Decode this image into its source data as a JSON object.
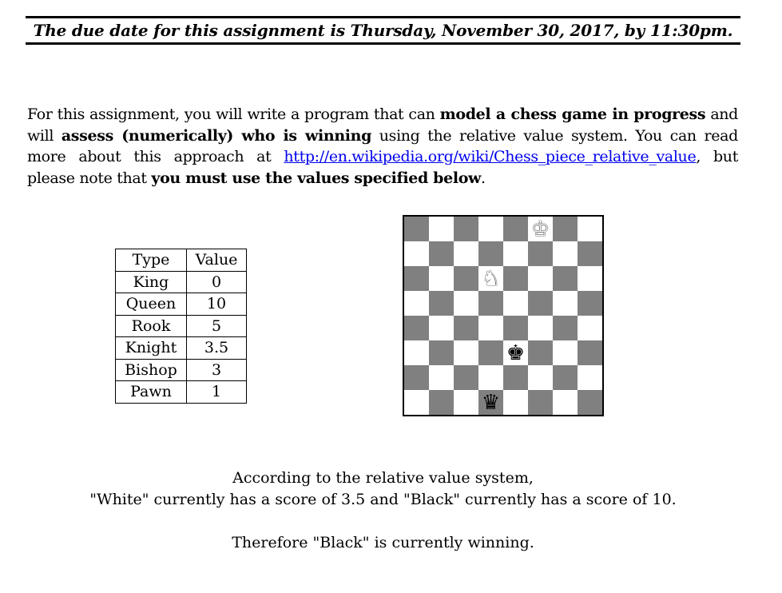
{
  "due_date": "The due date for this assignment is Thursday, November 30, 2017, by 11:30pm.",
  "intro": {
    "t1": "For this assignment, you will write a program that can ",
    "b1": "model a chess game in progress",
    "t2": " and will ",
    "b2": "assess (numerically) who is winning",
    "t3": " using the relative value system. You can read more about this approach at ",
    "link": "http://en.wikipedia.org/wiki/Chess_piece_relative_value",
    "t4": ", but please note that ",
    "b3": "you must use the values specified below",
    "t5": "."
  },
  "table": {
    "headers": [
      "Type",
      "Value"
    ],
    "rows": [
      [
        "King",
        "0"
      ],
      [
        "Queen",
        "10"
      ],
      [
        "Rook",
        "5"
      ],
      [
        "Knight",
        "3.5"
      ],
      [
        "Bishop",
        "3"
      ],
      [
        "Pawn",
        "1"
      ]
    ]
  },
  "board": {
    "light_color": "#ffffff",
    "dark_color": "#808080",
    "pieces": [
      {
        "square": "f8",
        "piece": "king",
        "color": "white",
        "glyph": "♚"
      },
      {
        "square": "d6",
        "piece": "knight",
        "color": "white",
        "glyph": "♞"
      },
      {
        "square": "e3",
        "piece": "king",
        "color": "black",
        "glyph": "♚"
      },
      {
        "square": "d1",
        "piece": "queen",
        "color": "black",
        "glyph": "♛"
      }
    ]
  },
  "conclusion": {
    "line1": "According to the relative value system,",
    "line2": "\"White\" currently has a score of 3.5 and \"Black\" currently has a score of 10.",
    "line3": "Therefore \"Black\" is currently winning."
  }
}
